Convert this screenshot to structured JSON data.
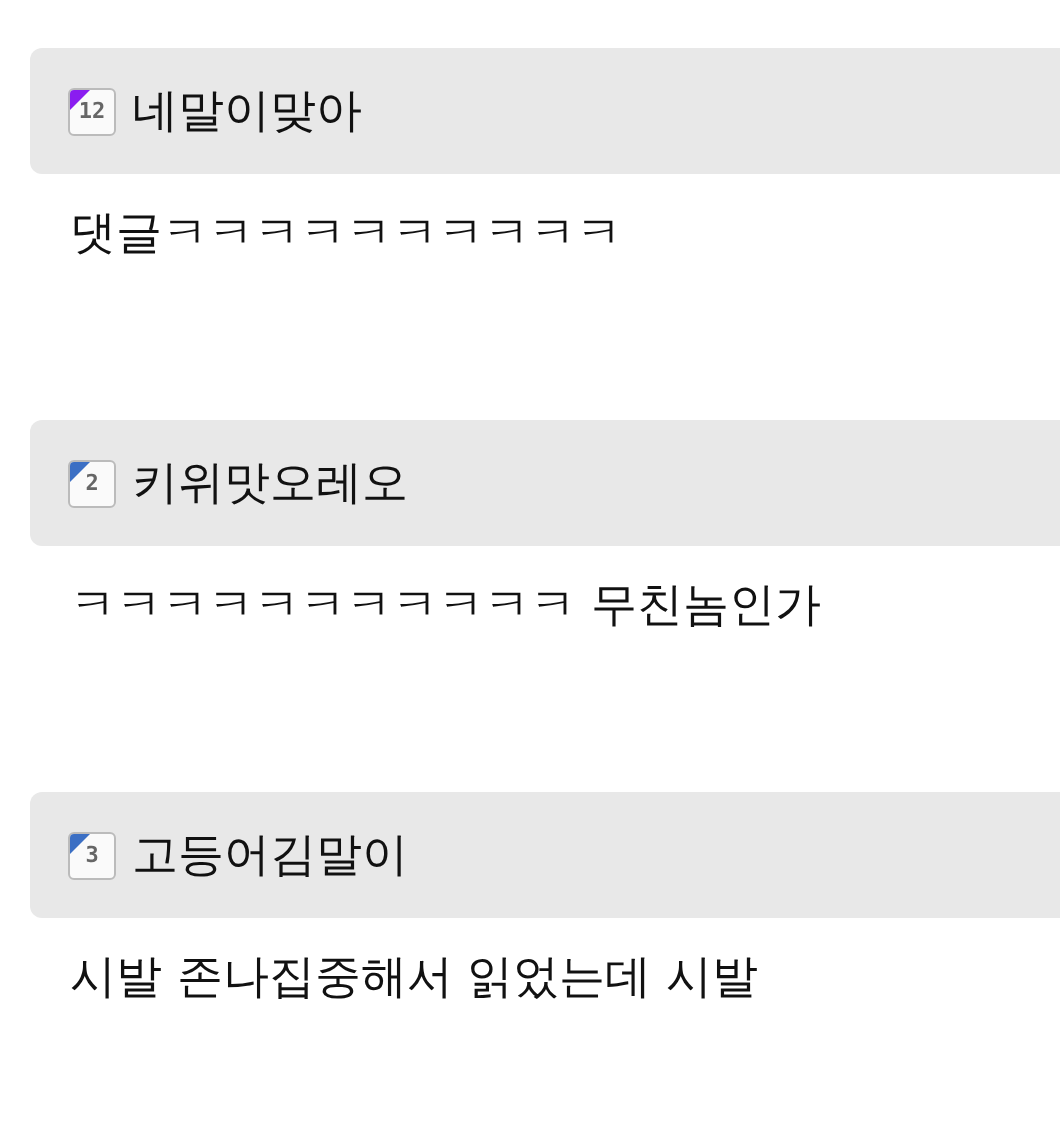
{
  "comments": [
    {
      "level": "12",
      "color": "#8a1cf0",
      "author": "네말이맞아",
      "text": "댓글ㅋㅋㅋㅋㅋㅋㅋㅋㅋㅋ"
    },
    {
      "level": "2",
      "color": "#3b6fc4",
      "author": "키위맛오레오",
      "text": "ㅋㅋㅋㅋㅋㅋㅋㅋㅋㅋㅋ 무친놈인가"
    },
    {
      "level": "3",
      "color": "#3b6fc4",
      "author": "고등어김말이",
      "text": "시발 존나집중해서 읽었는데 시발"
    }
  ]
}
